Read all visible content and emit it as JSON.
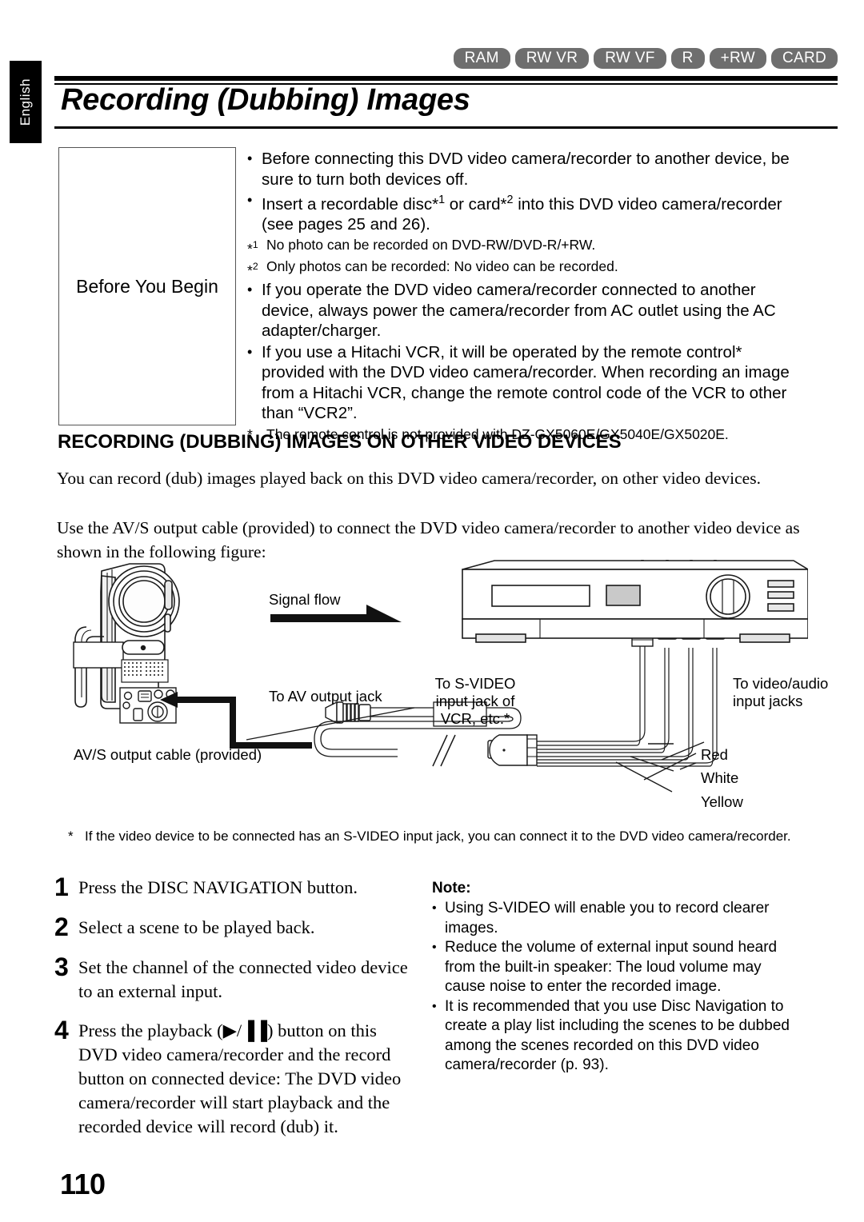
{
  "language_tab": "English",
  "disc_badges": [
    {
      "label": "RAM"
    },
    {
      "label": "RW VR"
    },
    {
      "label": "RW VF"
    },
    {
      "label": "R"
    },
    {
      "label": "+RW"
    },
    {
      "label": "CARD"
    }
  ],
  "title": "Recording (Dubbing) Images",
  "before_you_begin": {
    "label": "Before You Begin",
    "bullets": [
      "Before connecting this DVD video camera/recorder to another device, be sure to turn both devices off.",
      "Insert a recordable disc*1 or card*2 into this DVD video camera/recorder (see pages 25 and 26).",
      "If you operate the DVD video camera/recorder connected to another device, always power the camera/recorder from AC outlet using the AC adapter/charger.",
      "If you use a Hitachi VCR, it will be operated by the remote control* provided with the DVD video camera/recorder. When recording an image from a Hitachi VCR, change the remote control code of the VCR to other than “VCR2”."
    ],
    "footnote_1_mark": "*1",
    "footnote_1": "No photo can be recorded on DVD-RW/DVD-R/+RW.",
    "footnote_2_mark": "*2",
    "footnote_2": "Only photos can be recorded: No video can be recorded.",
    "footnote_3_mark": "*",
    "footnote_3": "The remote control is not provided with DZ-GX5060E/GX5040E/GX5020E."
  },
  "section_heading": "RECORDING (DUBBING) IMAGES ON OTHER VIDEO DEVICES",
  "body": {
    "paragraph_1": "You can record (dub) images played back on this DVD video camera/recorder, on other video devices.",
    "paragraph_2": "Use the AV/S output cable (provided) to connect the DVD video camera/recorder to another video device as shown in the following figure:"
  },
  "figure": {
    "signal_flow": "Signal flow",
    "to_av_output_jack": "To AV output jack",
    "av_s_output_cable": "AV/S output cable (provided)",
    "to_svideo_line1": "To S-VIDEO",
    "to_svideo_line2": "input jack of",
    "to_svideo_line3": "VCR, etc.*",
    "to_video_audio_line1": "To video/audio",
    "to_video_audio_line2": "input jacks",
    "plug_red": "Red",
    "plug_white": "White",
    "plug_yellow": "Yellow"
  },
  "figure_footnote": {
    "mark": "*",
    "text": "If the video device to be connected has an S-VIDEO input jack, you can connect it to the DVD video camera/recorder."
  },
  "steps": [
    {
      "num": "1",
      "text": "Press the DISC NAVIGATION button."
    },
    {
      "num": "2",
      "text": "Select a scene to be played back."
    },
    {
      "num": "3",
      "text": "Set the channel of the connected video device to an external input."
    },
    {
      "num": "4",
      "text": "Press the playback (▶/▐▐) button on this DVD video camera/recorder and the record button on connected device: The DVD video camera/recorder will start playback and the recorded device will record (dub) it."
    }
  ],
  "note": {
    "title": "Note:",
    "bullets": [
      "Using S-VIDEO will enable you to record clearer images.",
      "Reduce the volume of external input sound heard from the built-in speaker: The loud volume may cause noise to enter the recorded image.",
      "It is recommended that you use Disc Navigation to create a play list including the scenes to be dubbed among the scenes recorded on this DVD video camera/recorder (p. 93)."
    ]
  },
  "page_number": "110",
  "colors": {
    "badge_bg": "#6e6e6e",
    "tab_bg": "#000000",
    "line": "#000000"
  }
}
